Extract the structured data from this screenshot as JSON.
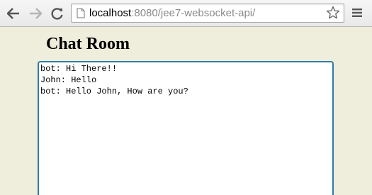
{
  "browser": {
    "back_icon": "back-arrow-icon",
    "forward_icon": "forward-arrow-icon",
    "reload_icon": "reload-icon",
    "address": {
      "host": "localhost",
      "rest": ":8080/jee7-websocket-api/"
    },
    "star_icon": "star-icon",
    "menu_icon": "menu-icon"
  },
  "page": {
    "title": "Chat Room",
    "messages": [
      "bot: Hi There!!",
      "John: Hello",
      "bot: Hello John, How are you?"
    ]
  },
  "colors": {
    "page_background": "#efeddb",
    "chat_border": "#2c7da8"
  }
}
